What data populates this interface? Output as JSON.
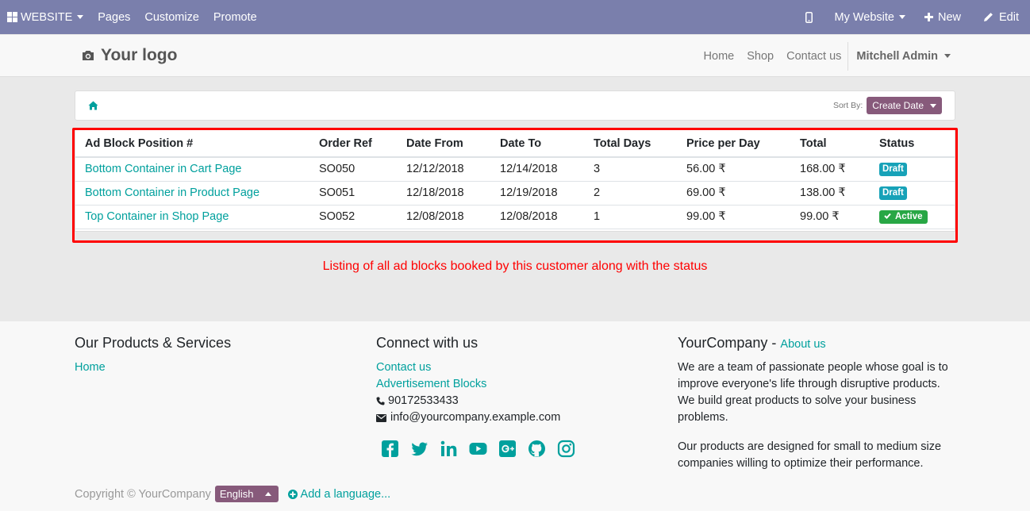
{
  "topbar": {
    "website_label": "WEBSITE",
    "menu": [
      "Pages",
      "Customize",
      "Promote"
    ],
    "my_website_label": "My Website",
    "new_label": "New",
    "edit_label": "Edit",
    "bar_color": "#7a7fac"
  },
  "header": {
    "logo_text": "Your logo",
    "nav": [
      "Home",
      "Shop",
      "Contact us"
    ],
    "user": "Mitchell Admin"
  },
  "breadcrumb": {
    "sort_label": "Sort By:",
    "sort_value": "Create Date"
  },
  "table": {
    "columns": [
      "Ad Block Position #",
      "Order Ref",
      "Date From",
      "Date To",
      "Total Days",
      "Price per Day",
      "Total",
      "Status"
    ],
    "rows": [
      {
        "position": "Bottom Container in Cart Page",
        "order": "SO050",
        "from": "12/12/2018",
        "to": "12/14/2018",
        "days": "3",
        "price": "56.00 ₹",
        "total": "168.00 ₹",
        "status": "Draft"
      },
      {
        "position": "Bottom Container in Product Page",
        "order": "SO051",
        "from": "12/18/2018",
        "to": "12/19/2018",
        "days": "2",
        "price": "69.00 ₹",
        "total": "138.00 ₹",
        "status": "Draft"
      },
      {
        "position": "Top Container in Shop Page",
        "order": "SO052",
        "from": "12/08/2018",
        "to": "12/08/2018",
        "days": "1",
        "price": "99.00 ₹",
        "total": "99.00 ₹",
        "status": "Active"
      }
    ]
  },
  "caption": "Listing of all ad blocks booked by this customer along with the status",
  "footer": {
    "col1": {
      "title": "Our Products & Services",
      "links": [
        "Home"
      ]
    },
    "col2": {
      "title": "Connect with us",
      "links": [
        "Contact us",
        "Advertisement Blocks"
      ],
      "phone": "90172533433",
      "email": "info@yourcompany.example.com",
      "social_icons": [
        "facebook-icon",
        "twitter-icon",
        "linkedin-icon",
        "youtube-icon",
        "google-plus-icon",
        "github-icon",
        "instagram-icon"
      ]
    },
    "col3": {
      "company": "YourCompany",
      "separator": " - ",
      "about_link": "About us",
      "p1": "We are a team of passionate people whose goal is to improve everyone's life through disruptive products. We build great products to solve your business problems.",
      "p2": "Our products are designed for small to medium size companies willing to optimize their performance."
    },
    "copyright": "Copyright © YourCompany",
    "language": "English",
    "add_language": "Add a language..."
  },
  "colors": {
    "accent": "#00a09d",
    "brand": "#875a7b",
    "highlight": "#ff0000"
  }
}
